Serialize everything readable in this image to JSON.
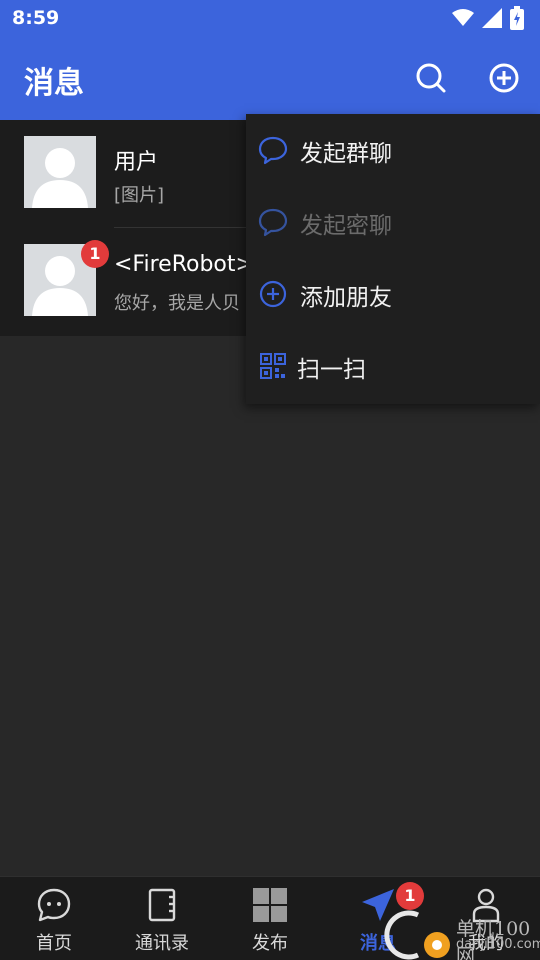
{
  "status_bar": {
    "time": "8:59",
    "icons": [
      "wifi-icon",
      "signal-icon",
      "battery-icon"
    ]
  },
  "header": {
    "title": "消息",
    "actions": [
      "search-icon",
      "add-circle-icon"
    ]
  },
  "chats": [
    {
      "name": "用户",
      "preview": "[图片]",
      "unread": null
    },
    {
      "name": "<FireRobot>",
      "preview": "您好，我是人贝",
      "unread": "1"
    }
  ],
  "dropdown_menu": {
    "items": [
      {
        "label": "发起群聊",
        "icon": "chat-bubble-icon",
        "disabled": false
      },
      {
        "label": "发起密聊",
        "icon": "chat-bubble-icon",
        "disabled": true
      },
      {
        "label": "添加朋友",
        "icon": "add-circle-icon",
        "disabled": false
      },
      {
        "label": "扫一扫",
        "icon": "qr-scan-icon",
        "disabled": false
      }
    ]
  },
  "bottom_nav": {
    "items": [
      {
        "label": "首页",
        "icon": "chat-dots-icon"
      },
      {
        "label": "通讯录",
        "icon": "contacts-book-icon"
      },
      {
        "label": "发布",
        "icon": "grid-icon"
      },
      {
        "label": "消息",
        "icon": "send-icon",
        "active": true,
        "badge": "1"
      },
      {
        "label": "我的",
        "icon": "person-icon"
      }
    ]
  },
  "watermark": {
    "line1": "单机100网",
    "line2": "danji100.com"
  },
  "colors": {
    "primary": "#3c64dc",
    "badge": "#e23b3b",
    "background": "#282828",
    "menu_bg": "#1f1f1f"
  }
}
